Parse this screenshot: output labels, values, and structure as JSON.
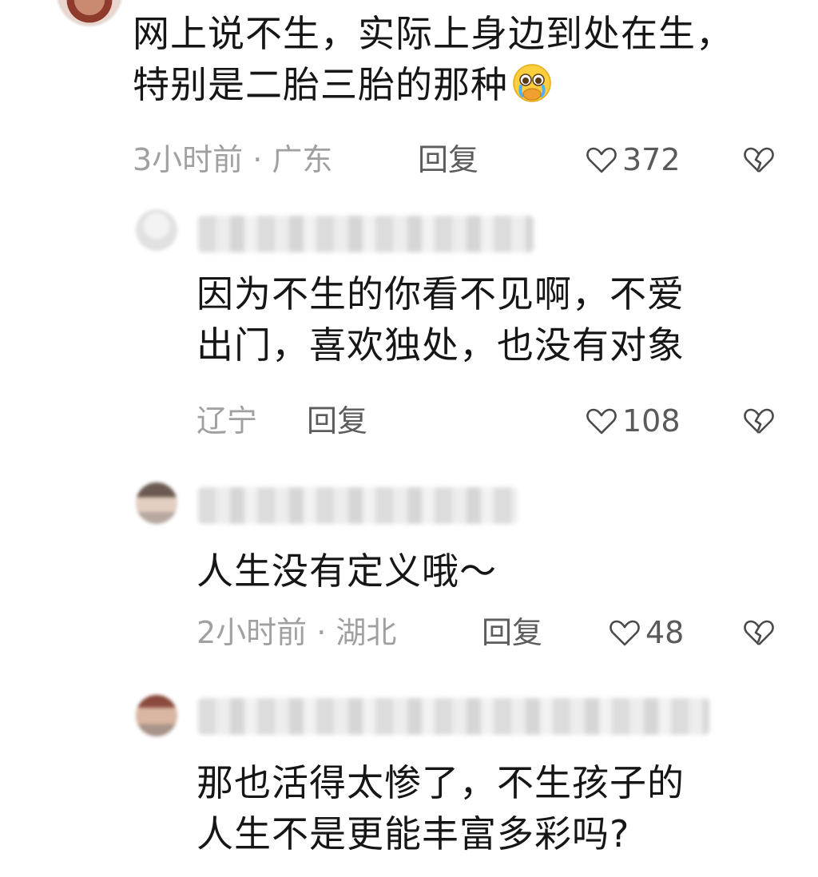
{
  "comments": [
    {
      "text_line1": "网上说不生，实际上身边到处在生，",
      "text_line2": "特别是二胎三胎的那种",
      "emoji": "crying-face-emoji",
      "time": "3小时前 · 广东",
      "reply_label": "回复",
      "likes": "372"
    },
    {
      "text_line1": "因为不生的你看不见啊，不爱",
      "text_line2": "出门，喜欢独处，也没有对象",
      "location": "辽宁",
      "reply_label": "回复",
      "likes": "108"
    },
    {
      "text_line1": "人生没有定义哦～",
      "time": "2小时前 · 湖北",
      "reply_label": "回复",
      "likes": "48"
    },
    {
      "text_line1": "那也活得太惨了，不生孩子的",
      "text_line2": "人生不是更能丰富多彩吗?"
    }
  ],
  "colors": {
    "text": "#161616",
    "meta": "#a0a0a0",
    "reply": "#5c5c5c"
  },
  "icons": [
    "heart-outline-icon",
    "broken-heart-icon"
  ]
}
